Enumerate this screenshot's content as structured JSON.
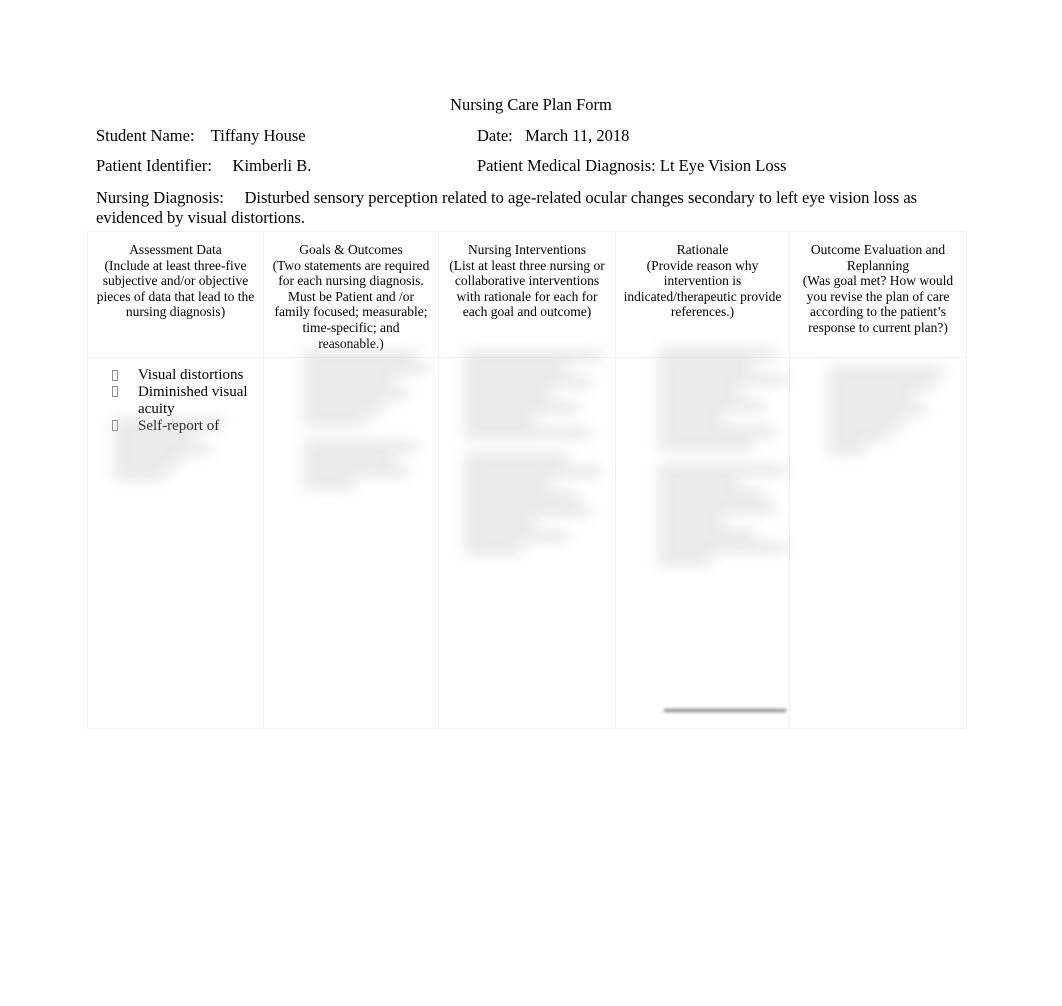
{
  "document": {
    "title": "Nursing Care Plan Form"
  },
  "meta": {
    "student_name_label": "Student Name:",
    "student_name_value": "Tiffany House",
    "date_label": "Date:",
    "date_value": "March 11, 2018",
    "patient_identifier_label": "Patient Identifier:",
    "patient_identifier_value": "Kimberli B.",
    "medical_diagnosis_label": "Patient Medical Diagnosis:",
    "medical_diagnosis_value": "Lt Eye Vision Loss"
  },
  "nursing_diagnosis": {
    "label": "Nursing Diagnosis:",
    "value": "Disturbed sensory perception related to age-related ocular changes secondary to left eye vision loss as evidenced by visual distortions."
  },
  "table": {
    "columns": [
      {
        "title": "Assessment Data",
        "subtitle": "(Include at least three-five subjective and/or objective pieces of data that lead to the nursing diagnosis)"
      },
      {
        "title": "Goals & Outcomes",
        "subtitle": "(Two statements are required for each nursing diagnosis. Must be Patient and /or family focused; measurable; time-specific; and reasonable.)"
      },
      {
        "title": "Nursing Interventions",
        "subtitle": "(List at least three nursing or collaborative interventions with rationale for each for each goal and outcome)"
      },
      {
        "title": "Rationale",
        "subtitle": "(Provide reason why intervention is indicated/therapeutic provide references.)"
      },
      {
        "title": "Outcome Evaluation and Replanning",
        "subtitle": "(Was goal met? How would you revise the plan of care according to the patient’s response to current plan?)"
      }
    ],
    "assessment_items": [
      "Visual distortions",
      "Diminished visual acuity",
      "Self-report of"
    ]
  },
  "colors": {
    "page_background": "#ffffff",
    "text": "#000000",
    "table_border": "#f0f0f0",
    "redaction_block": "#b9b9b9"
  }
}
